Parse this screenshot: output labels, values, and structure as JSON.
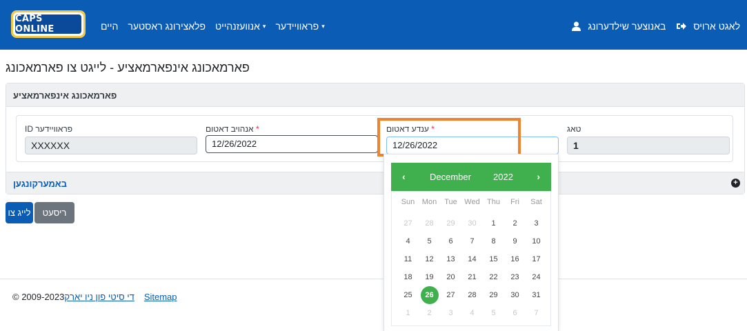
{
  "app": {
    "logo_text": "CAPS ONLINE"
  },
  "nav": {
    "links": [
      {
        "label": "היים"
      },
      {
        "label": "פלאצירונג ראסטער"
      },
      {
        "label": "אנוועזנהייט",
        "caret": "▾"
      },
      {
        "label": "פראוויידער",
        "caret": "▾"
      }
    ],
    "user": "באנוצער שילדערונג",
    "logout": "לאגט ארויס"
  },
  "page": {
    "title": "פארמאכונג אינפארמאציע - לייגט צו פארמאכונג"
  },
  "card": {
    "header": "פארמאכונג אינפארמאציע",
    "fields": {
      "provider_id": {
        "label": "ID פראוויידער",
        "value": "XXXXXX"
      },
      "start_date": {
        "label": "אנהויב דאטום",
        "required": "*",
        "value": "12/26/2022"
      },
      "end_date": {
        "label": "ענדע דאטום",
        "required": "*",
        "value": "12/26/2022"
      },
      "day": {
        "label": "טאג",
        "value": "1"
      }
    },
    "collapse_label": "באמערקונגען",
    "collapse_icon": "plus-circle-icon"
  },
  "buttons": {
    "add": "לייג צו",
    "reset": "ריסעט"
  },
  "footer": {
    "copyright": "© 2009-2023",
    "city_link": "די סיטי פון ניו יארק",
    "sitemap": "Sitemap"
  },
  "colors": {
    "nav": "#0b5cb4",
    "accent": "#3fb04d",
    "highlight": "#f0832d"
  },
  "datepicker": {
    "prev": "‹",
    "next": "›",
    "month": "December",
    "year": "2022",
    "weekdays": [
      "Sun",
      "Mon",
      "Tue",
      "Wed",
      "Thu",
      "Fri",
      "Sat"
    ],
    "weeks": [
      [
        "27",
        "28",
        "29",
        "30",
        "1",
        "2",
        "3"
      ],
      [
        "4",
        "5",
        "6",
        "7",
        "8",
        "9",
        "10"
      ],
      [
        "11",
        "12",
        "13",
        "14",
        "15",
        "16",
        "17"
      ],
      [
        "18",
        "19",
        "20",
        "21",
        "22",
        "23",
        "24"
      ],
      [
        "25",
        "26",
        "27",
        "28",
        "29",
        "30",
        "31"
      ],
      [
        "1",
        "2",
        "3",
        "4",
        "5",
        "6",
        "7"
      ]
    ],
    "muted": [
      [
        0,
        0
      ],
      [
        0,
        1
      ],
      [
        0,
        2
      ],
      [
        0,
        3
      ],
      [
        5,
        0
      ],
      [
        5,
        1
      ],
      [
        5,
        2
      ],
      [
        5,
        3
      ],
      [
        5,
        4
      ],
      [
        5,
        5
      ],
      [
        5,
        6
      ]
    ],
    "selected": "26"
  }
}
